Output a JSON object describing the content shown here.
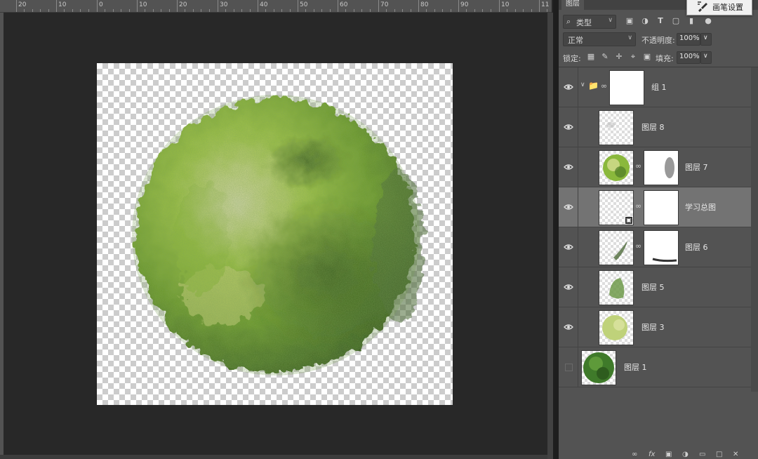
{
  "ruler": {
    "labels": [
      "20",
      "10",
      "0",
      "10",
      "20",
      "30",
      "40",
      "50",
      "60",
      "70",
      "80",
      "90",
      "10",
      "11"
    ]
  },
  "panel": {
    "tab_label": "图层",
    "tooltip": "画笔设置",
    "filter": {
      "kind_label": "类型",
      "icons": [
        "image-filter-icon",
        "adjustment-filter-icon",
        "text-filter-icon",
        "shape-filter-icon",
        "smart-object-filter-icon"
      ]
    },
    "blend_mode": "正常",
    "opacity_label": "不透明度:",
    "opacity_value": "100%",
    "lock_label": "锁定:",
    "fill_label": "填充:",
    "fill_value": "100%"
  },
  "layers": [
    {
      "name": "组 1",
      "type": "group",
      "visible": true,
      "selected": false
    },
    {
      "name": "图层 8",
      "type": "layer",
      "visible": true,
      "selected": false
    },
    {
      "name": "图层 7",
      "type": "layer-with-mask",
      "visible": true,
      "selected": false
    },
    {
      "name": "学习总图",
      "type": "smart-object-with-mask",
      "visible": true,
      "selected": true
    },
    {
      "name": "图层 6",
      "type": "layer-with-mask",
      "visible": true,
      "selected": false
    },
    {
      "name": "图层 5",
      "type": "layer",
      "visible": true,
      "selected": false
    },
    {
      "name": "图层 3",
      "type": "layer",
      "visible": true,
      "selected": false
    },
    {
      "name": "图层 1",
      "type": "layer",
      "visible": false,
      "selected": false
    }
  ],
  "colors": {
    "accent_green": "#7fae3a",
    "dark_green": "#3f6a22",
    "pale_green": "#c8d48a",
    "selected_row": "#737373"
  }
}
